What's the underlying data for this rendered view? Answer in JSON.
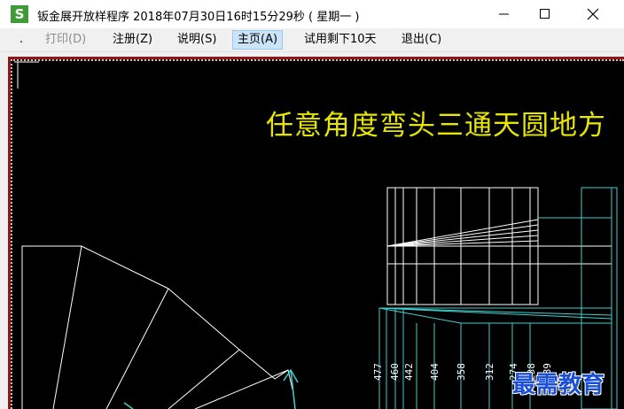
{
  "window": {
    "icon_letter": "S",
    "title": "钣金展开放样程序   2018年07月30日16时15分29秒 ( 星期一 )"
  },
  "menu": {
    "dot": ".",
    "print": "打印(D)",
    "register": "注册(Z)",
    "help": "说明(S)",
    "home": "主页(A)",
    "trial": "试用剩下10天",
    "exit": "退出(C)"
  },
  "drawing": {
    "title": "任意角度弯头三通天圆地方",
    "dimensions": [
      "477",
      "460",
      "442",
      "404",
      "358",
      "312",
      "274",
      "238",
      "189"
    ]
  },
  "watermark": "最需教育",
  "colors": {
    "background": "#000000",
    "lines_white": "#ffffff",
    "lines_cyan": "#3fd0d0",
    "title_yellow": "#e6e600",
    "border_red": "#8b1a1a"
  }
}
